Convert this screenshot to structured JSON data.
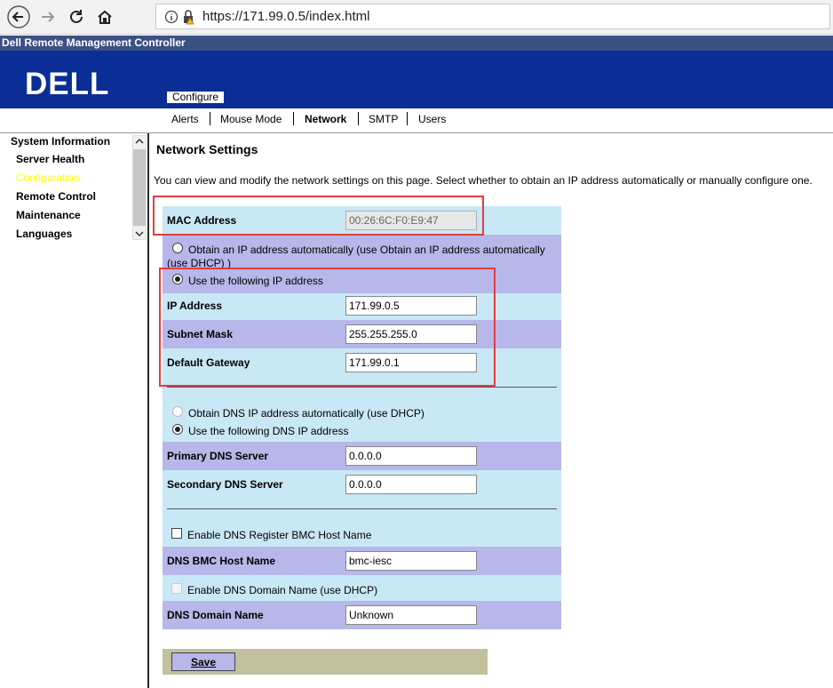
{
  "browser": {
    "url": "https://171.99.0.5/index.html"
  },
  "app_title": "Dell Remote Management Controller",
  "logo_text": "DELL",
  "section_tag": "Configure",
  "tabs": [
    {
      "label": "Alerts"
    },
    {
      "label": "Mouse Mode"
    },
    {
      "label": "Network",
      "active": true
    },
    {
      "label": "SMTP"
    },
    {
      "label": "Users"
    }
  ],
  "sidebar": {
    "items": [
      {
        "label": "System Information"
      },
      {
        "label": "Server Health"
      },
      {
        "label": "Configuration",
        "selected": true
      },
      {
        "label": "Remote Control"
      },
      {
        "label": "Maintenance"
      },
      {
        "label": "Languages"
      }
    ]
  },
  "page": {
    "title": "Network Settings",
    "intro": "You can view and modify the network settings on this page. Select whether to obtain an IP address automatically or manually configure one.",
    "mac_label": "MAC Address",
    "mac_value": "00:26:6C:F0:E9:47",
    "ip_auto_label_1": "Obtain an IP address automatically (use Obtain an IP address automatically",
    "ip_auto_label_2": "(use DHCP) )",
    "ip_manual_label": "Use the following IP address",
    "ip_address_label": "IP Address",
    "ip_address_value": "171.99.0.5",
    "subnet_label": "Subnet Mask",
    "subnet_value": "255.255.255.0",
    "gateway_label": "Default Gateway",
    "gateway_value": "171.99.0.1",
    "dns_auto_label": "Obtain DNS IP address automatically (use DHCP)",
    "dns_manual_label": "Use the following DNS IP address",
    "primary_dns_label": "Primary DNS Server",
    "primary_dns_value": "0.0.0.0",
    "secondary_dns_label": "Secondary DNS Server",
    "secondary_dns_value": "0.0.0.0",
    "dns_register_label": "Enable DNS Register BMC Host Name",
    "dns_host_label": "DNS BMC Host Name",
    "dns_host_value": "bmc-iesc",
    "dns_domain_dhcp_label": "Enable DNS Domain Name (use DHCP)",
    "dns_domain_label": "DNS Domain Name",
    "dns_domain_value": "Unknown",
    "save_label": "Save"
  },
  "colors": {
    "banner": "#0a2e96",
    "title_strip": "#3b5183",
    "row_light": "#c8e8f6",
    "row_dark": "#b7b7e9",
    "selected_nav": "#ffff00",
    "highlight": "#e53c3c"
  }
}
